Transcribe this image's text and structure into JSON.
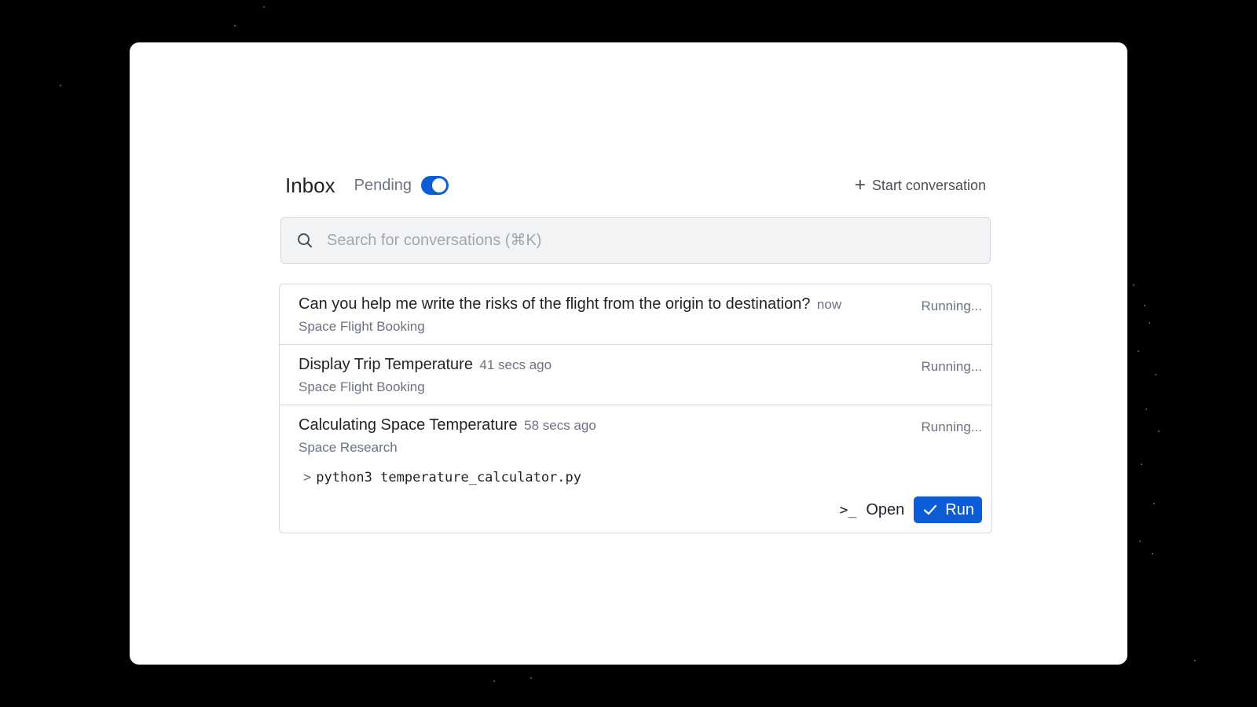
{
  "header": {
    "title": "Inbox",
    "pending_label": "Pending",
    "pending_toggle_on": true,
    "start_label": "Start conversation",
    "start_icon": "plus-icon"
  },
  "search": {
    "placeholder": "Search for conversations (⌘K)",
    "icon": "search-icon"
  },
  "conversations": [
    {
      "title": "Can you help me write the risks of the flight from the origin to destination?",
      "time": "now",
      "subtitle": "Space Flight Booking",
      "status": "Running..."
    },
    {
      "title": "Display Trip Temperature",
      "time": "41 secs ago",
      "subtitle": "Space Flight Booking",
      "status": "Running..."
    },
    {
      "title": "Calculating Space Temperature",
      "time": "58 secs ago",
      "subtitle": "Space Research",
      "status": "Running...",
      "command_prompt": ">",
      "command": "python3 temperature_calculator.py",
      "open_label": "Open",
      "run_label": "Run"
    }
  ],
  "colors": {
    "accent": "#0b5cd5",
    "background": "#000000",
    "panel": "#ffffff"
  }
}
